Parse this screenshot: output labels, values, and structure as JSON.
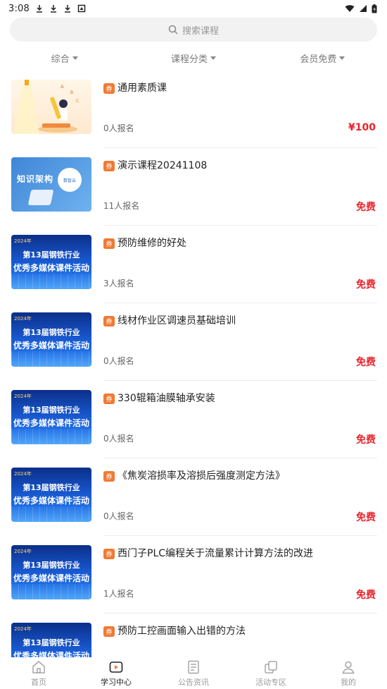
{
  "status_bar": {
    "time": "3:08",
    "left_icons": [
      "download-icon",
      "download-icon",
      "download-icon",
      "notification-icon"
    ],
    "right_icons": [
      "wifi-icon",
      "signal-icon",
      "battery-icon"
    ]
  },
  "search": {
    "placeholder": "搜索课程"
  },
  "filters": [
    {
      "label": "综合"
    },
    {
      "label": "课程分类"
    },
    {
      "label": "会员免费"
    }
  ],
  "courses": [
    {
      "tag": "券",
      "title": "通用素质课",
      "enrolled": "0人报名",
      "price": "¥100",
      "thumb": "generic"
    },
    {
      "tag": "券",
      "title": "演示课程20241108",
      "enrolled": "11人报名",
      "price": "免费",
      "thumb": "knowledge",
      "thumb_text": "知识架构",
      "thumb_badge": "数智云"
    },
    {
      "tag": "券",
      "title": "预防维修的好处",
      "enrolled": "3人报名",
      "price": "免费",
      "thumb": "event"
    },
    {
      "tag": "券",
      "title": "线材作业区调速员基础培训",
      "enrolled": "0人报名",
      "price": "免费",
      "thumb": "event"
    },
    {
      "tag": "券",
      "title": "330辊箱油膜轴承安装",
      "enrolled": "0人报名",
      "price": "免费",
      "thumb": "event"
    },
    {
      "tag": "券",
      "title": "《焦炭溶损率及溶损后强度测定方法》",
      "enrolled": "0人报名",
      "price": "免费",
      "thumb": "event"
    },
    {
      "tag": "券",
      "title": "西门子PLC编程关于流量累计计算方法的改进",
      "enrolled": "1人报名",
      "price": "免费",
      "thumb": "event"
    },
    {
      "tag": "券",
      "title": "预防工控画面输入出错的方法",
      "enrolled": "",
      "price": "",
      "thumb": "event"
    }
  ],
  "event_thumb": {
    "year": "2024年",
    "line1": "第13届钢铁行业",
    "line2": "优秀多媒体课件活动"
  },
  "tabs": [
    {
      "label": "首页",
      "icon": "home-icon",
      "active": false
    },
    {
      "label": "学习中心",
      "icon": "study-center-icon",
      "active": true
    },
    {
      "label": "公告资讯",
      "icon": "news-icon",
      "active": false
    },
    {
      "label": "活动专区",
      "icon": "activity-icon",
      "active": false
    },
    {
      "label": "我的",
      "icon": "profile-icon",
      "active": false
    }
  ],
  "colors": {
    "accent": "#f07a33",
    "price": "#e8242c",
    "active_tab": "#222222",
    "inactive_tab": "#9a9a9a"
  }
}
